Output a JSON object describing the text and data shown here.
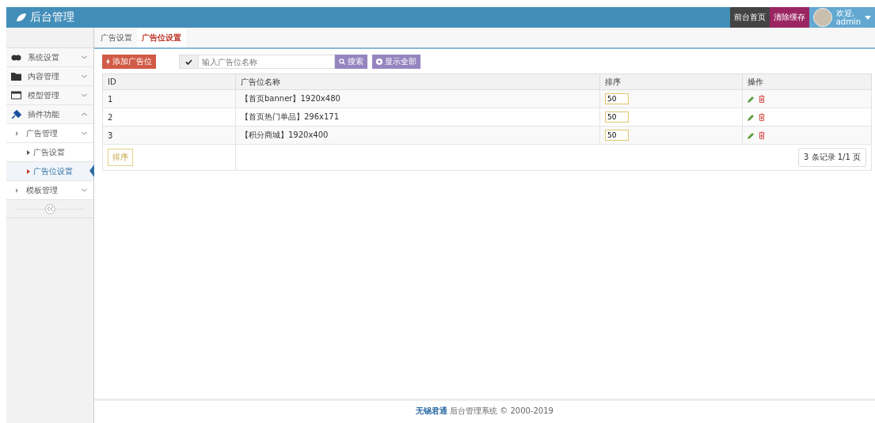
{
  "header": {
    "title": "后台管理",
    "buttons": [
      {
        "label": "前台首页",
        "kind": "home"
      },
      {
        "label": "清除缓存",
        "kind": "cache"
      }
    ],
    "user": {
      "greeting": "欢迎,",
      "name": "admin"
    }
  },
  "sidebar": {
    "items": [
      {
        "label": "系统设置",
        "expanded": false,
        "selected": false
      },
      {
        "label": "内容管理",
        "expanded": false,
        "selected": false
      },
      {
        "label": "模型管理",
        "expanded": false,
        "selected": false
      },
      {
        "label": "插件功能",
        "expanded": true,
        "selected": false,
        "children": [
          {
            "label": "广告管理",
            "expanded": true,
            "selected": false,
            "children": [
              {
                "label": "广告设置",
                "selected": false
              },
              {
                "label": "广告位设置",
                "selected": true
              }
            ]
          },
          {
            "label": "模板管理",
            "expanded": false,
            "selected": false
          }
        ]
      }
    ]
  },
  "tabs": [
    {
      "label": "广告设置",
      "selected": false
    },
    {
      "label": "广告位设置",
      "selected": true
    }
  ],
  "toolbar": {
    "add_button": "添加广告位",
    "search": {
      "placeholder": "输入广告位名称"
    },
    "search_button": "搜索",
    "show_all_button": "显示全部"
  },
  "table": {
    "columns": [
      "ID",
      "广告位名称",
      "排序",
      "操作"
    ],
    "rows": [
      {
        "id": "1",
        "name": "【首页banner】1920x480",
        "sort": "50"
      },
      {
        "id": "2",
        "name": "【首页热门单品】296x171",
        "sort": "50"
      },
      {
        "id": "3",
        "name": "【积分商城】1920x400",
        "sort": "50"
      }
    ],
    "sort_button": "排序",
    "pager": "3 条记录 1/1 页"
  },
  "footer": {
    "company": "无锡君通",
    "text": "后台管理系统 © 2000-2019"
  }
}
